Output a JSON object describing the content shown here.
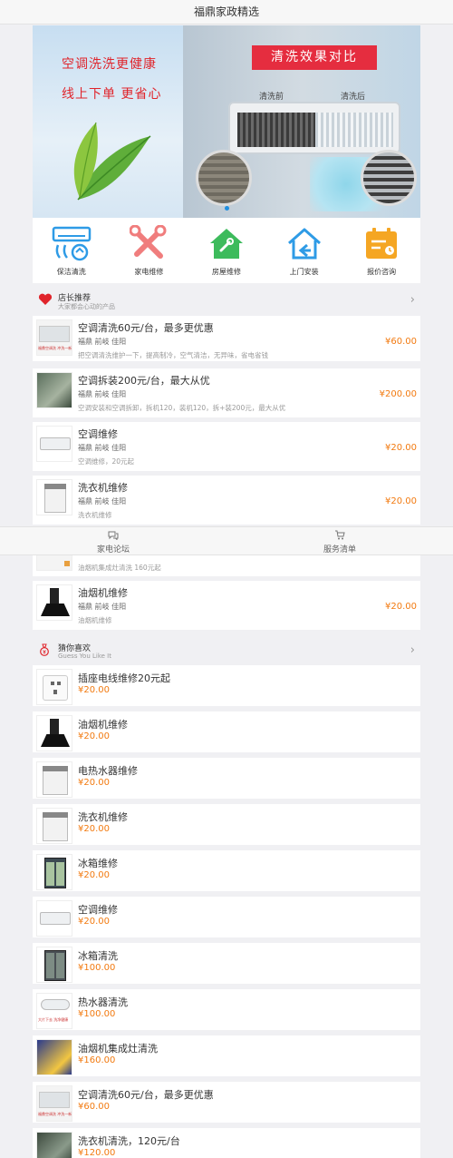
{
  "header": {
    "title": "福鼎家政精选"
  },
  "banner": {
    "line1": "空调洗洗更健康",
    "line2": "线上下单 更省心",
    "tag": "清洗效果对比",
    "before": "清洗前",
    "after": "清洗后"
  },
  "categories": [
    {
      "label": "保洁清洗",
      "icon": "ac-cleaning-icon",
      "color": "#2e9be6"
    },
    {
      "label": "家电维修",
      "icon": "repair-tools-icon",
      "color": "#f07d7d"
    },
    {
      "label": "房屋维修",
      "icon": "house-repair-icon",
      "color": "#3dbb5c"
    },
    {
      "label": "上门安装",
      "icon": "home-install-icon",
      "color": "#2e9be6"
    },
    {
      "label": "报价咨询",
      "icon": "calendar-quote-icon",
      "color": "#f5a623"
    }
  ],
  "recommend": {
    "title": "店长推荐",
    "subtitle": "大家都会心动的产品",
    "items": [
      {
        "title": "空调清洗60元/台，最多更优惠",
        "location": "福鼎 前岐 佳阳",
        "desc": "把空调清洗维护一下，提高制冷，空气清洁，无异味，省电省钱",
        "price": "¥60.00",
        "thumb_caption": "福鼎空调洗 冲洗一新"
      },
      {
        "title": "空调拆装200元/台，最大从优",
        "location": "福鼎 前岐 佳阳",
        "desc": "空调安装和空调拆卸，拆机120，装机120，拆+装200元，最大从优",
        "price": "¥200.00"
      },
      {
        "title": "空调维修",
        "location": "福鼎 前岐 佳阳",
        "desc": "空调维修，20元起",
        "price": "¥20.00"
      },
      {
        "title": "洗衣机维修",
        "location": "福鼎 前岐 佳阳",
        "desc": "洗衣机维修",
        "price": "¥20.00"
      },
      {
        "desc": "油烟机集成灶清洗 160元起"
      },
      {
        "title": "油烟机维修",
        "location": "福鼎 前岐 佳阳",
        "desc": "油烟机维修",
        "price": "¥20.00"
      }
    ]
  },
  "tabbar": {
    "tabs": [
      {
        "label": "家电论坛",
        "icon": "forum-icon"
      },
      {
        "label": "服务清单",
        "icon": "cart-icon"
      }
    ]
  },
  "guess": {
    "title": "猜你喜欢",
    "subtitle": "Guess You Like It",
    "items": [
      {
        "title": "插座电线维修20元起",
        "price": "¥20.00"
      },
      {
        "title": "油烟机维修",
        "price": "¥20.00"
      },
      {
        "title": "电热水器维修",
        "price": "¥20.00"
      },
      {
        "title": "洗衣机维修",
        "price": "¥20.00"
      },
      {
        "title": "冰箱维修",
        "price": "¥20.00"
      },
      {
        "title": "空调维修",
        "price": "¥20.00"
      },
      {
        "title": "冰箱清洗",
        "price": "¥100.00"
      },
      {
        "title": "热水器清洗",
        "price": "¥100.00",
        "thumb_caption": "大片下去 洗净健康"
      },
      {
        "title": "油烟机集成灶清洗",
        "price": "¥160.00"
      },
      {
        "title": "空调清洗60元/台，最多更优惠",
        "price": "¥60.00",
        "thumb_caption": "福鼎空调洗 冲洗一新"
      },
      {
        "title": "洗衣机清洗，120元/台",
        "price": "¥120.00"
      }
    ]
  },
  "colors": {
    "accent": "#f27a10",
    "red": "#e0242b",
    "tag": "#e52d3f"
  }
}
